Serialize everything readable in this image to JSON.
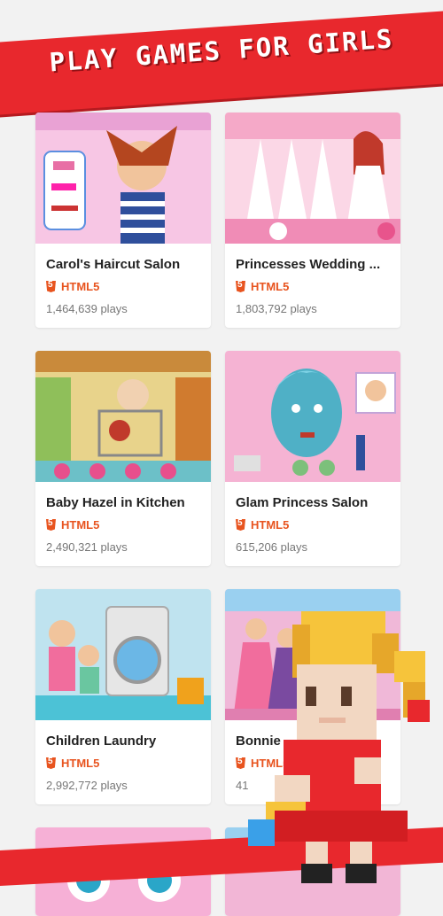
{
  "banner": {
    "text": "PLAY GAMES FOR GIRLS"
  },
  "games": [
    {
      "title": "Carol's Haircut Salon",
      "tech": "HTML5",
      "plays": "1,464,639 plays"
    },
    {
      "title": "Princesses Wedding ...",
      "tech": "HTML5",
      "plays": "1,803,792 plays"
    },
    {
      "title": "Baby Hazel in Kitchen",
      "tech": "HTML5",
      "plays": "2,490,321 plays"
    },
    {
      "title": "Glam Princess Salon",
      "tech": "HTML5",
      "plays": "615,206 plays"
    },
    {
      "title": "Children Laundry",
      "tech": "HTML5",
      "plays": "2,992,772 plays"
    },
    {
      "title": "Bonnie",
      "tech": "HTML5",
      "plays": "41"
    }
  ],
  "colors": {
    "brand": "#e8282d",
    "html5": "#e8541f"
  }
}
